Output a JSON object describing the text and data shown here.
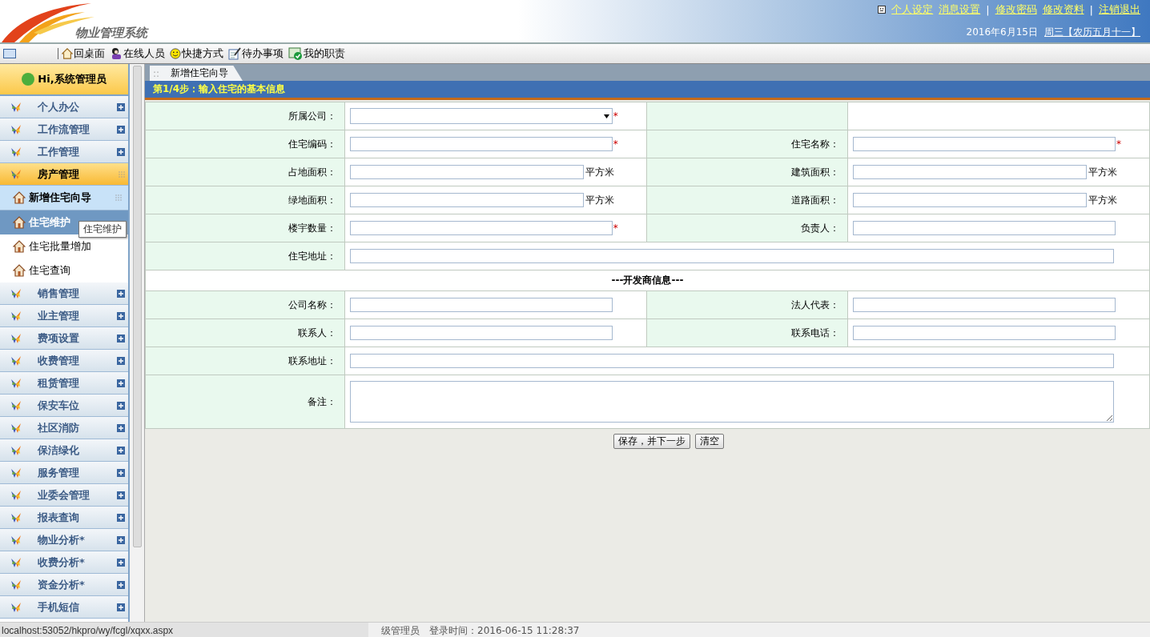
{
  "header": {
    "logo_text": "物业管理系统",
    "links": [
      {
        "kind": "link",
        "text": "个人设定"
      },
      {
        "kind": "link",
        "text": "消息设置"
      },
      {
        "kind": "sep",
        "text": "|"
      },
      {
        "kind": "link",
        "text": "修改密码"
      },
      {
        "kind": "link",
        "text": "修改资料"
      },
      {
        "kind": "sep",
        "text": "|"
      },
      {
        "kind": "link",
        "text": "注销退出"
      }
    ],
    "date": "2016年6月15日",
    "weekday_lunar": "周三【农历五月十一】"
  },
  "toolbar": [
    {
      "kind": "home",
      "label": "回桌面"
    },
    {
      "kind": "people",
      "label": "在线人员"
    },
    {
      "kind": "smile",
      "label": "快捷方式"
    },
    {
      "kind": "note",
      "label": "待办事项"
    },
    {
      "kind": "check",
      "label": "我的职责"
    }
  ],
  "sidebar": {
    "greeting": "Hi,系统管理员",
    "items": [
      {
        "kind": "group",
        "label": "个人办公",
        "expanded": false
      },
      {
        "kind": "group",
        "label": "工作流管理",
        "expanded": false
      },
      {
        "kind": "group",
        "label": "工作管理",
        "expanded": false
      },
      {
        "kind": "group",
        "label": "房产管理",
        "expanded": true
      },
      {
        "kind": "sub",
        "label": "新增住宅向导",
        "selected": true,
        "hovered": false
      },
      {
        "kind": "sub",
        "label": "住宅维护",
        "selected": false,
        "hovered": true
      },
      {
        "kind": "sub",
        "label": "住宅批量增加",
        "selected": false,
        "hovered": false
      },
      {
        "kind": "sub",
        "label": "住宅查询",
        "selected": false,
        "hovered": false
      },
      {
        "kind": "group",
        "label": "销售管理",
        "expanded": false
      },
      {
        "kind": "group",
        "label": "业主管理",
        "expanded": false
      },
      {
        "kind": "group",
        "label": "费项设置",
        "expanded": false
      },
      {
        "kind": "group",
        "label": "收费管理",
        "expanded": false
      },
      {
        "kind": "group",
        "label": "租赁管理",
        "expanded": false
      },
      {
        "kind": "group",
        "label": "保安车位",
        "expanded": false
      },
      {
        "kind": "group",
        "label": "社区消防",
        "expanded": false
      },
      {
        "kind": "group",
        "label": "保洁绿化",
        "expanded": false
      },
      {
        "kind": "group",
        "label": "服务管理",
        "expanded": false
      },
      {
        "kind": "group",
        "label": "业委会管理",
        "expanded": false
      },
      {
        "kind": "group",
        "label": "报表查询",
        "expanded": false
      },
      {
        "kind": "group",
        "label": "物业分析*",
        "expanded": false
      },
      {
        "kind": "group",
        "label": "收费分析*",
        "expanded": false
      },
      {
        "kind": "group",
        "label": "资金分析*",
        "expanded": false
      },
      {
        "kind": "group",
        "label": "手机短信",
        "expanded": false
      }
    ],
    "tooltip": "住宅维护"
  },
  "tab": {
    "grip": "::",
    "label": "新增住宅向导"
  },
  "step_title": "第1/4步：输入住宅的基本信息",
  "form": [
    {
      "kind": "pair",
      "fields": [
        {
          "label": "所属公司：",
          "kind": "select",
          "required": true
        }
      ]
    },
    {
      "kind": "pair",
      "fields": [
        {
          "label": "住宅编码：",
          "kind": "text",
          "required": true
        },
        {
          "label": "住宅名称：",
          "kind": "text",
          "required": true
        }
      ]
    },
    {
      "kind": "pair",
      "fields": [
        {
          "label": "占地面积：",
          "kind": "text",
          "unit": "平方米",
          "required": false
        },
        {
          "label": "建筑面积：",
          "kind": "text",
          "unit": "平方米",
          "required": false
        }
      ]
    },
    {
      "kind": "pair",
      "fields": [
        {
          "label": "绿地面积：",
          "kind": "text",
          "unit": "平方米",
          "required": false
        },
        {
          "label": "道路面积：",
          "kind": "text",
          "unit": "平方米",
          "required": false
        }
      ]
    },
    {
      "kind": "pair",
      "fields": [
        {
          "label": "楼宇数量：",
          "kind": "text",
          "required": true
        },
        {
          "label": "负责人：",
          "kind": "text",
          "required": false
        }
      ]
    },
    {
      "kind": "wide",
      "fields": [
        {
          "label": "住宅地址：",
          "kind": "text",
          "required": false
        }
      ]
    },
    {
      "kind": "section",
      "title": "---开发商信息---"
    },
    {
      "kind": "pair",
      "fields": [
        {
          "label": "公司名称：",
          "kind": "text",
          "required": false
        },
        {
          "label": "法人代表：",
          "kind": "text",
          "required": false
        }
      ]
    },
    {
      "kind": "pair",
      "fields": [
        {
          "label": "联系人：",
          "kind": "text",
          "required": false
        },
        {
          "label": "联系电话：",
          "kind": "text",
          "required": false
        }
      ]
    },
    {
      "kind": "wide",
      "fields": [
        {
          "label": "联系地址：",
          "kind": "text",
          "required": false
        }
      ]
    },
    {
      "kind": "wide",
      "fields": [
        {
          "label": "备注：",
          "kind": "textarea",
          "required": false
        }
      ]
    }
  ],
  "required_mark": "*",
  "buttons": [
    "保存，并下一步",
    "清空"
  ],
  "status_bar": {
    "url": "localhost:53052/hkpro/wy/fcgl/xqxx.aspx",
    "text": "级管理员　登录时间：2016-06-15 11:28:37"
  }
}
